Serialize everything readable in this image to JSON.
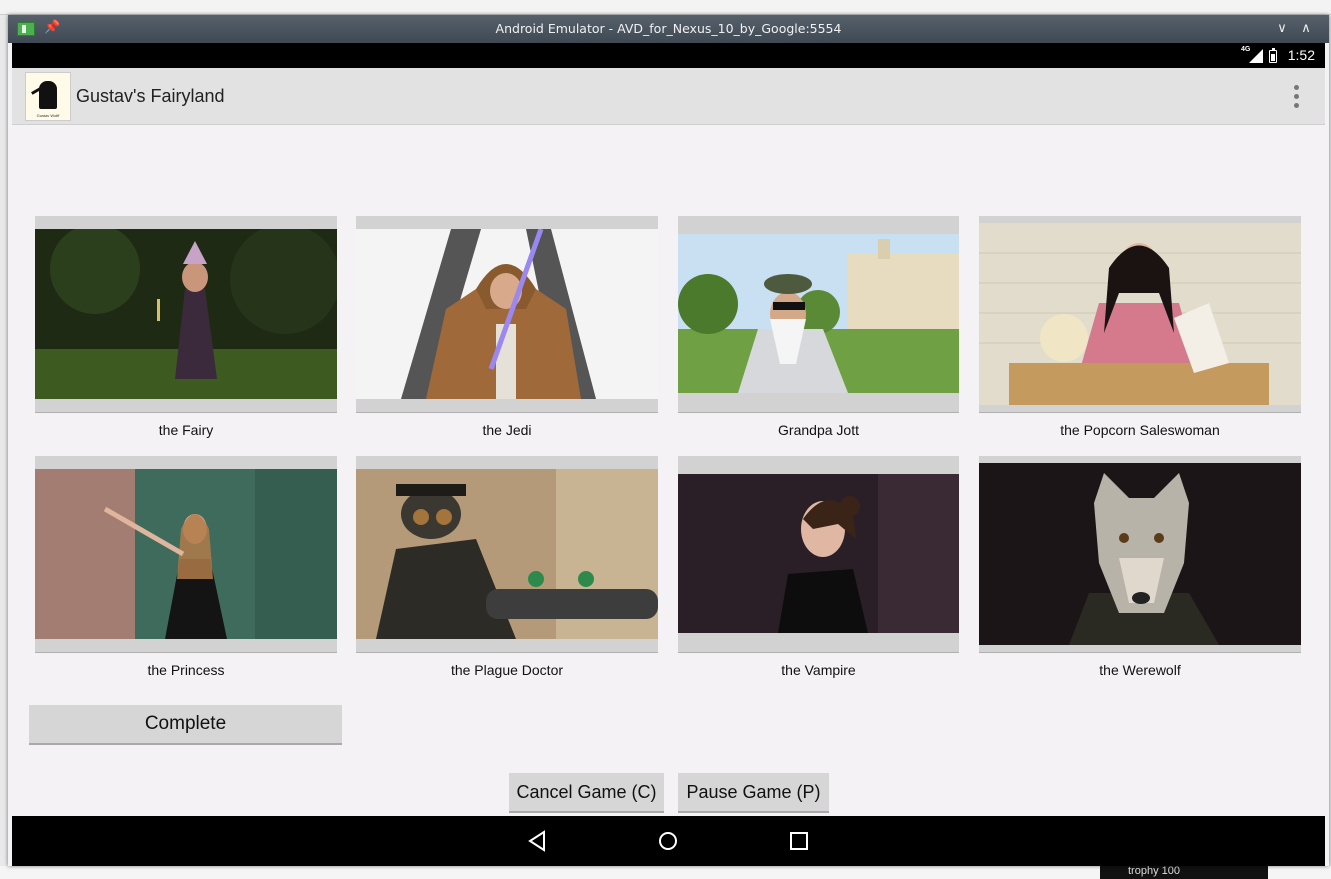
{
  "window": {
    "title": "Android Emulator - AVD_for_Nexus_10_by_Google:5554"
  },
  "status_bar": {
    "network": "4G",
    "time": "1:52"
  },
  "action_bar": {
    "app_title": "Gustav's Fairyland",
    "logo_caption": "Gustav Wolff"
  },
  "characters": [
    {
      "label": "the Fairy",
      "icon": "fairy-photo"
    },
    {
      "label": "the Jedi",
      "icon": "jedi-photo"
    },
    {
      "label": "Grandpa Jott",
      "icon": "grandpa-photo"
    },
    {
      "label": "the Popcorn Saleswoman",
      "icon": "popcorn-photo"
    },
    {
      "label": "the Princess",
      "icon": "princess-photo"
    },
    {
      "label": "the Plague Doctor",
      "icon": "plague-doctor-photo"
    },
    {
      "label": "the Vampire",
      "icon": "vampire-photo"
    },
    {
      "label": "the Werewolf",
      "icon": "werewolf-photo"
    }
  ],
  "buttons": {
    "complete": "Complete",
    "cancel": "Cancel Game (C)",
    "pause": "Pause Game (P)"
  },
  "background": {
    "taskbar_text": "trophy 100"
  }
}
